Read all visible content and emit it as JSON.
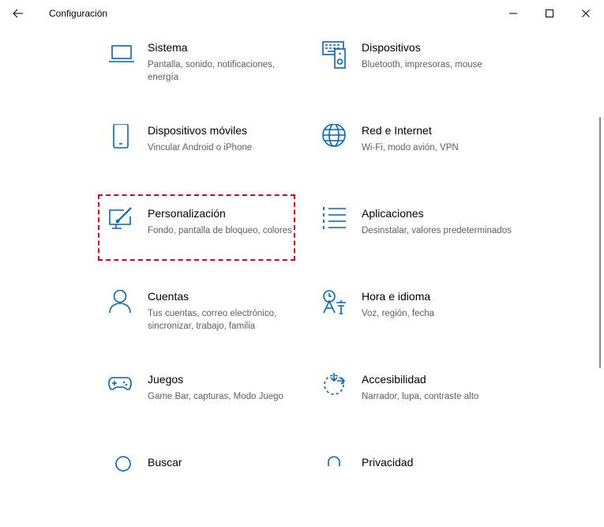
{
  "window": {
    "title": "Configuración",
    "controls": {
      "back": "arrow-left-icon",
      "minimize": "minimize-icon",
      "maximize": "maximize-icon",
      "close": "close-icon"
    }
  },
  "accent_color": "#0067c0",
  "highlight_color": "#e0001a",
  "highlighted_tile": "personalizacion",
  "categories": [
    {
      "id": "sistema",
      "name": "Sistema",
      "desc": "Pantalla, sonido, notificaciones, energía",
      "icon": "laptop-icon"
    },
    {
      "id": "dispositivos",
      "name": "Dispositivos",
      "desc": "Bluetooth, impresoras, mouse",
      "icon": "devices-icon"
    },
    {
      "id": "moviles",
      "name": "Dispositivos móviles",
      "desc": "Vincular Android o iPhone",
      "icon": "phone-icon"
    },
    {
      "id": "red",
      "name": "Red e Internet",
      "desc": "Wi-Fi, modo avión, VPN",
      "icon": "globe-icon"
    },
    {
      "id": "personalizacion",
      "name": "Personalización",
      "desc": "Fondo, pantalla de bloqueo, colores",
      "icon": "paint-icon"
    },
    {
      "id": "aplicaciones",
      "name": "Aplicaciones",
      "desc": "Desinstalar, valores predeterminados",
      "icon": "apps-list-icon"
    },
    {
      "id": "cuentas",
      "name": "Cuentas",
      "desc": "Tus cuentas, correo electrónico, sincronizar, trabajo, familia",
      "icon": "person-icon"
    },
    {
      "id": "hora",
      "name": "Hora e idioma",
      "desc": "Voz, región, fecha",
      "icon": "language-icon"
    },
    {
      "id": "juegos",
      "name": "Juegos",
      "desc": "Game Bar, capturas, Modo Juego",
      "icon": "gamepad-icon"
    },
    {
      "id": "accesibilidad",
      "name": "Accesibilidad",
      "desc": "Narrador, lupa, contraste alto",
      "icon": "accessibility-icon"
    },
    {
      "id": "buscar",
      "name": "Buscar",
      "desc": "",
      "icon": "search-icon"
    },
    {
      "id": "privacidad",
      "name": "Privacidad",
      "desc": "",
      "icon": "lock-icon"
    }
  ]
}
